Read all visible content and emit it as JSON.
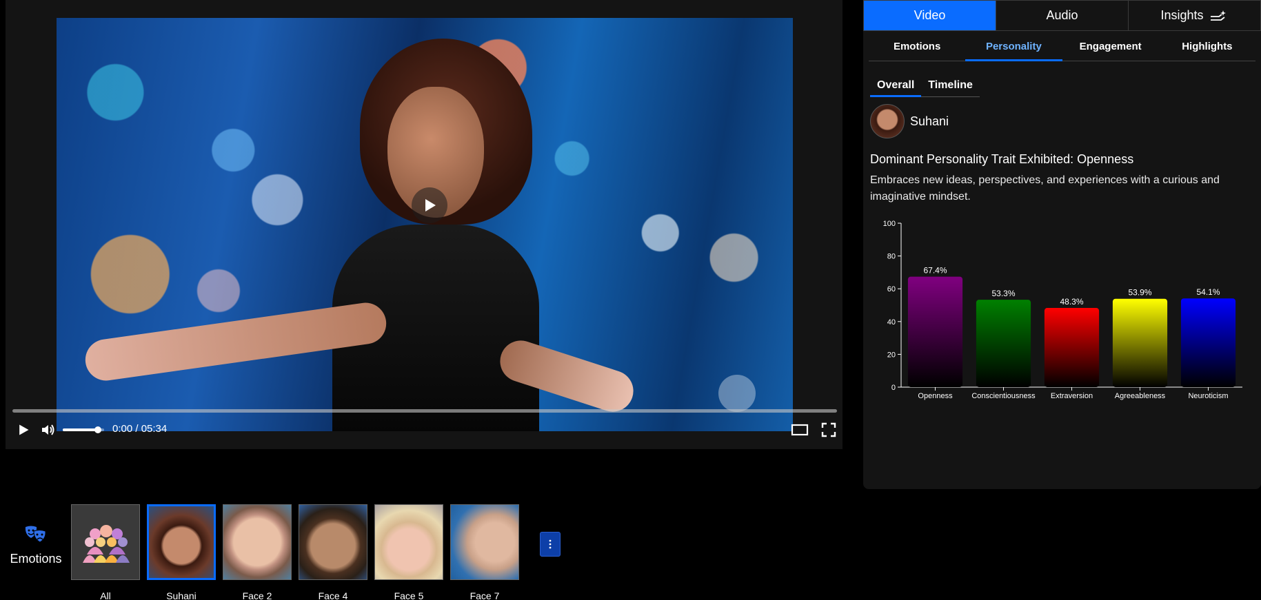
{
  "player": {
    "time_display": "0:00 / 05:34",
    "progress": 0.0,
    "volume": 0.85
  },
  "panel": {
    "main_tabs": [
      {
        "label": "Video",
        "active": true
      },
      {
        "label": "Audio",
        "active": false
      },
      {
        "label": "Insights",
        "active": false,
        "icon": "sparkle-hand-icon"
      }
    ],
    "sub_tabs": [
      {
        "label": "Emotions",
        "active": false
      },
      {
        "label": "Personality",
        "active": true
      },
      {
        "label": "Engagement",
        "active": false
      },
      {
        "label": "Highlights",
        "active": false
      }
    ],
    "view_tabs": [
      {
        "label": "Overall",
        "active": true
      },
      {
        "label": "Timeline",
        "active": false
      }
    ],
    "person_name": "Suhani",
    "trait_title": "Dominant Personality Trait Exhibited: Openness",
    "trait_description": "Embraces new ideas, perspectives, and experiences with a curious and imaginative mindset."
  },
  "chart_data": {
    "type": "bar",
    "categories": [
      "Openness",
      "Conscientiousness",
      "Extraversion",
      "Agreeableness",
      "Neuroticism"
    ],
    "values": [
      67.4,
      53.3,
      48.3,
      53.9,
      54.1
    ],
    "data_labels": [
      "67.4%",
      "53.3%",
      "48.3%",
      "53.9%",
      "54.1%"
    ],
    "colors": [
      "#800080",
      "#008000",
      "#ff0000",
      "#ffff00",
      "#0000ff"
    ],
    "ylim": [
      0,
      100
    ],
    "yticks": [
      0,
      20,
      40,
      60,
      80,
      100
    ],
    "title": "",
    "xlabel": "",
    "ylabel": ""
  },
  "bottom": {
    "section_label": "Emotions",
    "faces": [
      {
        "label": "All",
        "selected": false,
        "kind": "group"
      },
      {
        "label": "Suhani",
        "selected": true,
        "kind": "woman-dark"
      },
      {
        "label": "Face 2",
        "selected": false,
        "kind": "man-smile"
      },
      {
        "label": "Face 4",
        "selected": false,
        "kind": "man-dark"
      },
      {
        "label": "Face 5",
        "selected": false,
        "kind": "woman-blonde"
      },
      {
        "label": "Face 7",
        "selected": false,
        "kind": "woman-side"
      }
    ]
  }
}
